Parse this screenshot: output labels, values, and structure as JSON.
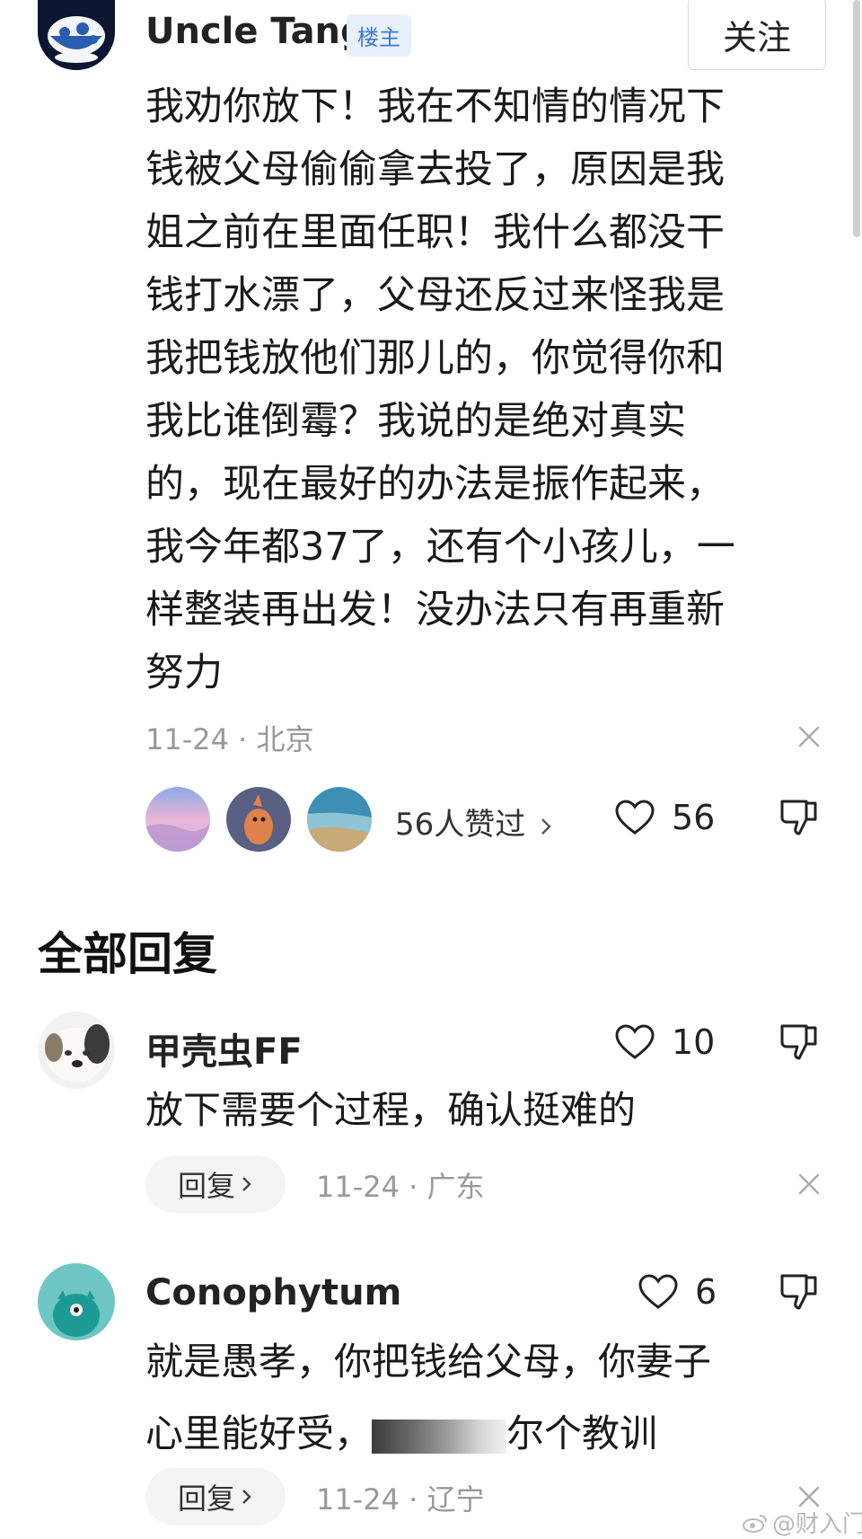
{
  "post": {
    "author": "Uncle Tang",
    "badge": "楼主",
    "follow_label": "关注",
    "body_lines": [
      "我劝你放下！我在不知情的情况下",
      "钱被父母偷偷拿去投了，原因是我",
      "姐之前在里面任职！我什么都没干",
      "钱打水漂了，父母还反过来怪我是",
      "我把钱放他们那儿的，你觉得你和",
      "我比谁倒霉？我说的是绝对真实",
      "的，现在最好的办法是振作起来，",
      "我今年都37了，还有个小孩儿，一",
      "样整装再出发！没办法只有再重新",
      "努力"
    ],
    "date": "11-24",
    "location": "北京",
    "likers_text": "56人赞过",
    "like_count": "56"
  },
  "replies": {
    "title": "全部回复",
    "items": [
      {
        "author": "甲壳虫FF",
        "like_count": "10",
        "body_lines": [
          "放下需要个过程，确认挺难的"
        ],
        "reply_label": "回复",
        "date": "11-24",
        "location": "广东"
      },
      {
        "author": "Conophytum",
        "like_count": "6",
        "body_lines": [
          "就是愚孝，你把钱给父母，你妻子"
        ],
        "line2_visible_start": "心里能好受，",
        "line2_visible_end": "尔个教训",
        "reply_label": "回复",
        "date": "11-24",
        "location": "辽宁"
      }
    ]
  },
  "watermark": "@财入门",
  "colors": {
    "badge_bg": "#e8f0fb",
    "badge_text": "#3b7ad9",
    "meta_gray": "#999999"
  },
  "icons": {
    "like": "heart-outline-icon",
    "dislike": "thumbs-down-outline-icon",
    "close": "close-icon",
    "chevron": "chevron-right-icon",
    "weibo": "weibo-logo-icon"
  }
}
